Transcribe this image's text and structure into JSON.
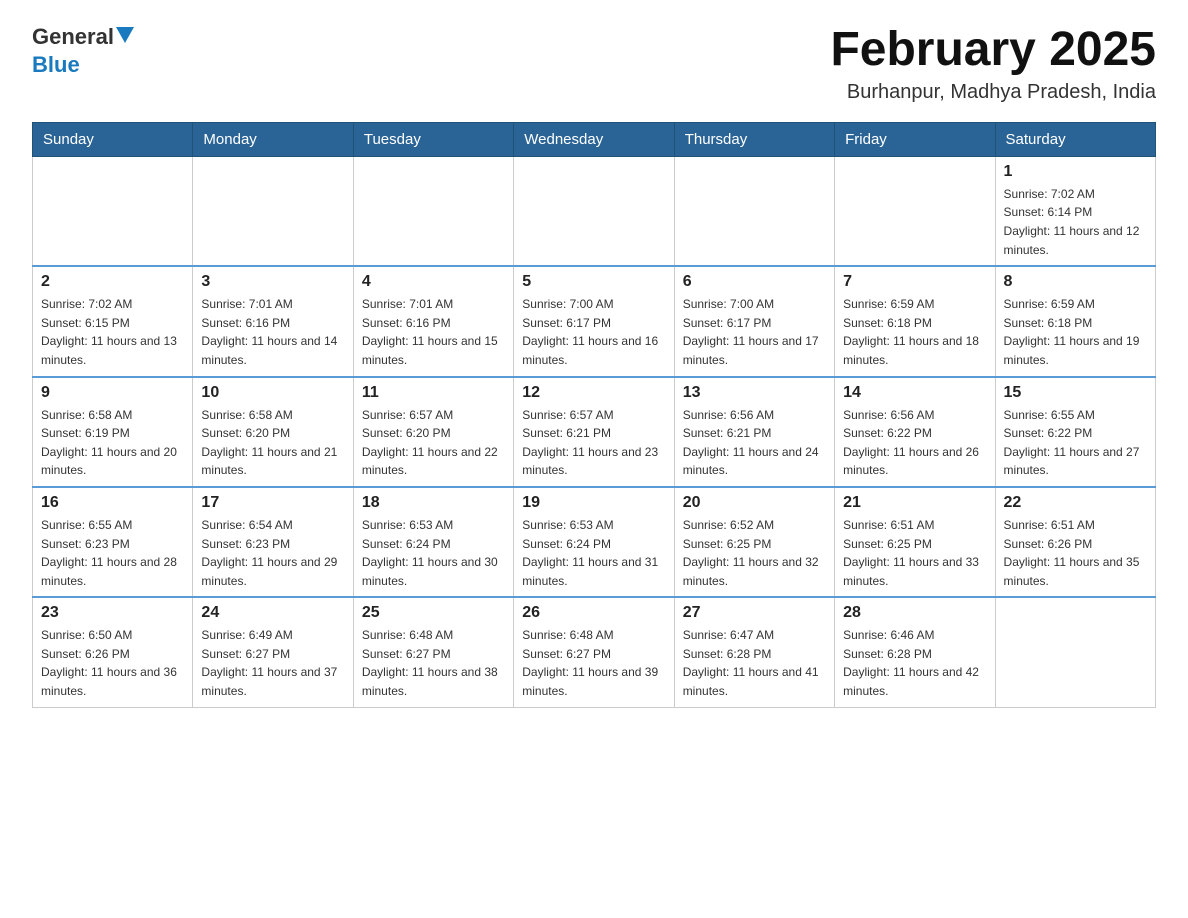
{
  "logo": {
    "general": "General",
    "blue": "Blue",
    "triangle": "▲"
  },
  "title": "February 2025",
  "location": "Burhanpur, Madhya Pradesh, India",
  "days_of_week": [
    "Sunday",
    "Monday",
    "Tuesday",
    "Wednesday",
    "Thursday",
    "Friday",
    "Saturday"
  ],
  "weeks": [
    [
      {
        "day": "",
        "info": ""
      },
      {
        "day": "",
        "info": ""
      },
      {
        "day": "",
        "info": ""
      },
      {
        "day": "",
        "info": ""
      },
      {
        "day": "",
        "info": ""
      },
      {
        "day": "",
        "info": ""
      },
      {
        "day": "1",
        "info": "Sunrise: 7:02 AM\nSunset: 6:14 PM\nDaylight: 11 hours and 12 minutes."
      }
    ],
    [
      {
        "day": "2",
        "info": "Sunrise: 7:02 AM\nSunset: 6:15 PM\nDaylight: 11 hours and 13 minutes."
      },
      {
        "day": "3",
        "info": "Sunrise: 7:01 AM\nSunset: 6:16 PM\nDaylight: 11 hours and 14 minutes."
      },
      {
        "day": "4",
        "info": "Sunrise: 7:01 AM\nSunset: 6:16 PM\nDaylight: 11 hours and 15 minutes."
      },
      {
        "day": "5",
        "info": "Sunrise: 7:00 AM\nSunset: 6:17 PM\nDaylight: 11 hours and 16 minutes."
      },
      {
        "day": "6",
        "info": "Sunrise: 7:00 AM\nSunset: 6:17 PM\nDaylight: 11 hours and 17 minutes."
      },
      {
        "day": "7",
        "info": "Sunrise: 6:59 AM\nSunset: 6:18 PM\nDaylight: 11 hours and 18 minutes."
      },
      {
        "day": "8",
        "info": "Sunrise: 6:59 AM\nSunset: 6:18 PM\nDaylight: 11 hours and 19 minutes."
      }
    ],
    [
      {
        "day": "9",
        "info": "Sunrise: 6:58 AM\nSunset: 6:19 PM\nDaylight: 11 hours and 20 minutes."
      },
      {
        "day": "10",
        "info": "Sunrise: 6:58 AM\nSunset: 6:20 PM\nDaylight: 11 hours and 21 minutes."
      },
      {
        "day": "11",
        "info": "Sunrise: 6:57 AM\nSunset: 6:20 PM\nDaylight: 11 hours and 22 minutes."
      },
      {
        "day": "12",
        "info": "Sunrise: 6:57 AM\nSunset: 6:21 PM\nDaylight: 11 hours and 23 minutes."
      },
      {
        "day": "13",
        "info": "Sunrise: 6:56 AM\nSunset: 6:21 PM\nDaylight: 11 hours and 24 minutes."
      },
      {
        "day": "14",
        "info": "Sunrise: 6:56 AM\nSunset: 6:22 PM\nDaylight: 11 hours and 26 minutes."
      },
      {
        "day": "15",
        "info": "Sunrise: 6:55 AM\nSunset: 6:22 PM\nDaylight: 11 hours and 27 minutes."
      }
    ],
    [
      {
        "day": "16",
        "info": "Sunrise: 6:55 AM\nSunset: 6:23 PM\nDaylight: 11 hours and 28 minutes."
      },
      {
        "day": "17",
        "info": "Sunrise: 6:54 AM\nSunset: 6:23 PM\nDaylight: 11 hours and 29 minutes."
      },
      {
        "day": "18",
        "info": "Sunrise: 6:53 AM\nSunset: 6:24 PM\nDaylight: 11 hours and 30 minutes."
      },
      {
        "day": "19",
        "info": "Sunrise: 6:53 AM\nSunset: 6:24 PM\nDaylight: 11 hours and 31 minutes."
      },
      {
        "day": "20",
        "info": "Sunrise: 6:52 AM\nSunset: 6:25 PM\nDaylight: 11 hours and 32 minutes."
      },
      {
        "day": "21",
        "info": "Sunrise: 6:51 AM\nSunset: 6:25 PM\nDaylight: 11 hours and 33 minutes."
      },
      {
        "day": "22",
        "info": "Sunrise: 6:51 AM\nSunset: 6:26 PM\nDaylight: 11 hours and 35 minutes."
      }
    ],
    [
      {
        "day": "23",
        "info": "Sunrise: 6:50 AM\nSunset: 6:26 PM\nDaylight: 11 hours and 36 minutes."
      },
      {
        "day": "24",
        "info": "Sunrise: 6:49 AM\nSunset: 6:27 PM\nDaylight: 11 hours and 37 minutes."
      },
      {
        "day": "25",
        "info": "Sunrise: 6:48 AM\nSunset: 6:27 PM\nDaylight: 11 hours and 38 minutes."
      },
      {
        "day": "26",
        "info": "Sunrise: 6:48 AM\nSunset: 6:27 PM\nDaylight: 11 hours and 39 minutes."
      },
      {
        "day": "27",
        "info": "Sunrise: 6:47 AM\nSunset: 6:28 PM\nDaylight: 11 hours and 41 minutes."
      },
      {
        "day": "28",
        "info": "Sunrise: 6:46 AM\nSunset: 6:28 PM\nDaylight: 11 hours and 42 minutes."
      },
      {
        "day": "",
        "info": ""
      }
    ]
  ]
}
